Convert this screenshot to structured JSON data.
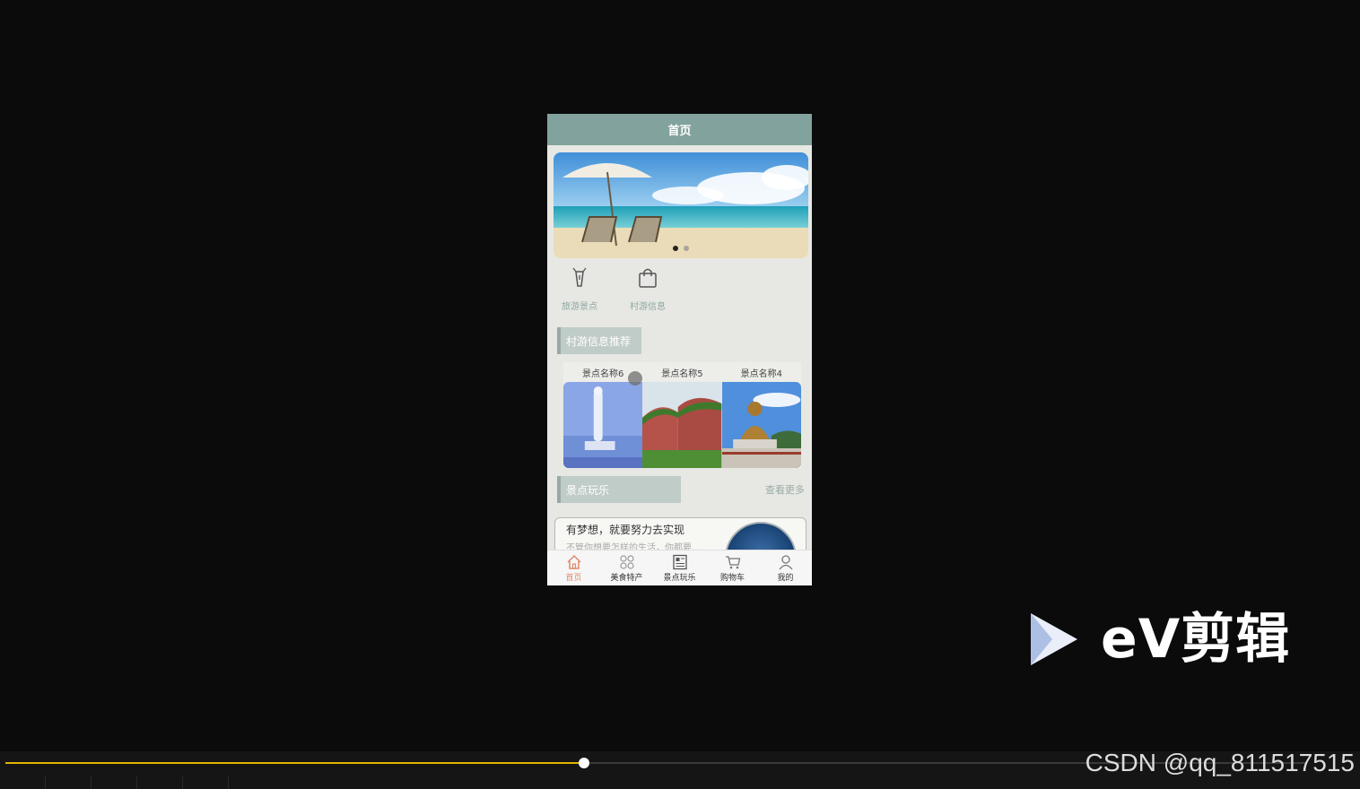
{
  "app": {
    "header_title": "首页"
  },
  "banner": {
    "dots": 2,
    "active_dot": 0
  },
  "quick_nav": [
    {
      "label": "旅游景点",
      "icon": "lighthouse-icon"
    },
    {
      "label": "村游信息",
      "icon": "shopping-bag-icon"
    }
  ],
  "sections": {
    "recommend_title": "村游信息推荐",
    "play_title": "景点玩乐",
    "more_label": "查看更多"
  },
  "cards": [
    {
      "title": "景点名称6"
    },
    {
      "title": "景点名称5"
    },
    {
      "title": "景点名称4"
    }
  ],
  "post": {
    "title": "有梦想，就要努力去实现",
    "desc": "不管你想要怎样的生活，你都要..."
  },
  "tabbar": [
    {
      "label": "首页",
      "icon": "home-icon",
      "active": true
    },
    {
      "label": "美食特产",
      "icon": "grid-icon",
      "active": false
    },
    {
      "label": "景点玩乐",
      "icon": "news-icon",
      "active": false
    },
    {
      "label": "购物车",
      "icon": "cart-icon",
      "active": false
    },
    {
      "label": "我的",
      "icon": "user-icon",
      "active": false
    }
  ],
  "player": {
    "watermark": "eV剪辑",
    "progress": 0.445,
    "credit": "CSDN @qq_811517515"
  },
  "colors": {
    "header": "#82a29d",
    "accent": "#e08a6a",
    "progress": "#e4b400"
  }
}
